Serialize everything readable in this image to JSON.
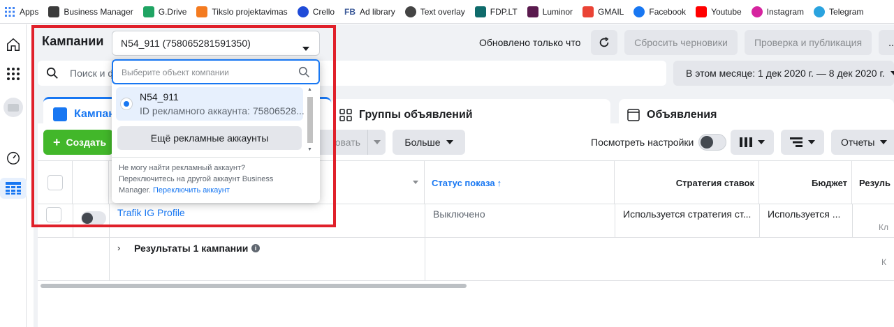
{
  "bookmarks": [
    {
      "label": "Apps",
      "icon": "apps-grid-icon",
      "color": "#4285f4"
    },
    {
      "label": "Business Manager",
      "icon": "business-manager-icon",
      "color": "#3b3b3b"
    },
    {
      "label": "G.Drive",
      "icon": "google-drive-icon",
      "color": "#1fa463"
    },
    {
      "label": "Tikslo projektavimas",
      "icon": "tikslo-icon",
      "color": "#f47b20"
    },
    {
      "label": "Crello",
      "icon": "crello-icon",
      "color": "#1f4bd8"
    },
    {
      "label": "Ad library",
      "icon": "fb-text-icon",
      "color": "#3b5998"
    },
    {
      "label": "Text overlay",
      "icon": "text-overlay-icon",
      "color": "#444444"
    },
    {
      "label": "FDP.LT",
      "icon": "fdp-icon",
      "color": "#0f6b6b"
    },
    {
      "label": "Luminor",
      "icon": "luminor-icon",
      "color": "#5a1a4e"
    },
    {
      "label": "GMAIL",
      "icon": "gmail-icon",
      "color": "#ea4335"
    },
    {
      "label": "Facebook",
      "icon": "facebook-icon",
      "color": "#1877f2"
    },
    {
      "label": "Youtube",
      "icon": "youtube-icon",
      "color": "#ff0000"
    },
    {
      "label": "Instagram",
      "icon": "instagram-icon",
      "color": "#d6249f"
    },
    {
      "label": "Telegram",
      "icon": "telegram-icon",
      "color": "#2aa3df"
    }
  ],
  "bookmark_fb_prefix": "FB",
  "header": {
    "title": "Кампании",
    "account_selected": "N54_911 (758065281591350)",
    "updated": "Обновлено только что",
    "reset_drafts": "Сбросить черновики",
    "review_publish": "Проверка и публикация",
    "more": "..."
  },
  "search": {
    "placeholder": "Поиск и ф"
  },
  "date_range": "В этом месяце: 1 дек 2020 г. — 8 дек 2020 г.",
  "tabs": {
    "campaigns": "Кампании",
    "ad_sets": "Группы объявлений",
    "ads": "Объявления"
  },
  "toolbar": {
    "create": "Создать",
    "edit_partial": "овать",
    "more": "Больше",
    "view_settings": "Посмотреть настройки",
    "reports": "Отчеты"
  },
  "table": {
    "headers": {
      "delivery": "Статус показа",
      "bid_strategy": "Стратегия ставок",
      "budget": "Бюджет",
      "results": "Резуль"
    },
    "rows": [
      {
        "name": "Trafik IG Profile",
        "delivery": "Выключено",
        "bid": "Используется стратегия ст...",
        "budget": "Используется ...",
        "results": "Кл"
      }
    ],
    "summary": "Результаты 1 кампании",
    "summary_results": "К"
  },
  "popup": {
    "search_placeholder": "Выберите объект компании",
    "account_name": "N54_911",
    "account_id": "ID рекламного аккаунта: 75806528...",
    "more_accounts": "Ещё рекламные аккаунты",
    "help_text": "Не могу найти рекламный аккаунт? Переключитесь на другой аккаунт Business Manager.",
    "switch_link": "Переключить аккаунт"
  },
  "colors": {
    "fb_blue": "#1877f2",
    "create_green": "#42b72a",
    "highlight_red": "#e0202a"
  }
}
